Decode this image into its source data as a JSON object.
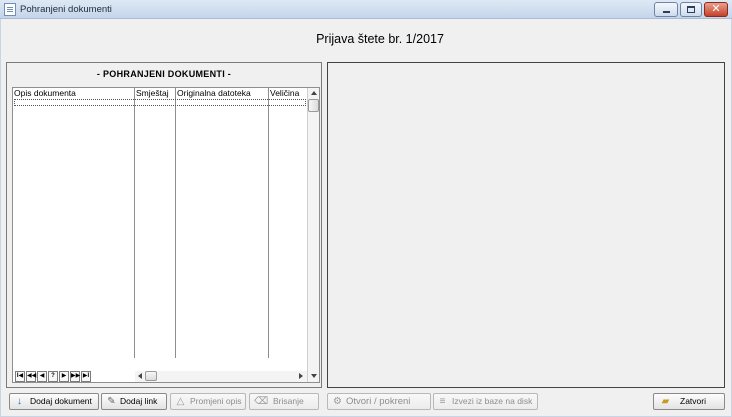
{
  "window": {
    "title": "Pohranjeni dokumenti"
  },
  "heading": "Prijava štete br. 1/2017",
  "panel": {
    "title": "- POHRANJENI DOKUMENTI -",
    "columns": [
      "Opis dokumenta",
      "Smještaj",
      "Originalna datoteka",
      "Veličina"
    ]
  },
  "navigator": {
    "buttons": [
      "I◀",
      "◀◀",
      "◀",
      "?",
      "▶",
      "▶▶",
      "▶I"
    ]
  },
  "buttons": {
    "add_document": "Dodaj dokument",
    "add_link": "Dodaj link",
    "rename": "Promjeni opis",
    "delete": "Brisanje",
    "open": "Otvori / pokreni",
    "export": "Izvezi iz baze na disk",
    "close": "Zatvori"
  },
  "colors": {
    "titlebar": "#c4d5ea",
    "close_button": "#c5402a",
    "background": "#f0f0f0"
  }
}
